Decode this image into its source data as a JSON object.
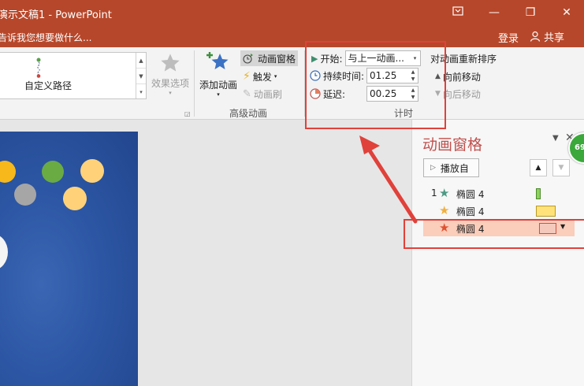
{
  "window": {
    "title": "演示文稿1 - PowerPoint",
    "tell_me": "告诉我您想要做什么...",
    "login": "登录",
    "share": "共享",
    "min_label": "—",
    "restore_label": "❐",
    "close_label": "✕"
  },
  "ribbon": {
    "gallery_item": "自定义路径",
    "effect_options": "效果选项",
    "add_animation": "添加动画",
    "animation_pane": "动画窗格",
    "trigger": "触发",
    "animation_painter": "动画刷",
    "advanced_group": "高级动画",
    "timing": {
      "start_label": "开始:",
      "start_value": "与上一动画...",
      "duration_label": "持续时间:",
      "duration_value": "01.25",
      "delay_label": "延迟:",
      "delay_value": "00.25",
      "group_label": "计时"
    },
    "reorder": {
      "title": "对动画重新排序",
      "move_earlier": "向前移动",
      "move_later": "向后移动"
    }
  },
  "pane": {
    "title": "动画窗格",
    "play_from": "播放自",
    "items": [
      {
        "num": "1",
        "name": "椭圆 4",
        "star_color": "#4e9a84",
        "bar_color": "#8bd35a",
        "bar_border": "#4e8a2c"
      },
      {
        "num": "",
        "name": "椭圆 4",
        "star_color": "#f0b040",
        "bar_color": "#ffe27a",
        "bar_border": "#b89a2a"
      },
      {
        "num": "",
        "name": "椭圆 4",
        "star_color": "#e05030",
        "bar_color": "#f6c9bd",
        "bar_border": "#d05040"
      }
    ],
    "badge": "69"
  },
  "colors": {
    "accent": "#b7472a",
    "annotation": "#e0413a"
  }
}
